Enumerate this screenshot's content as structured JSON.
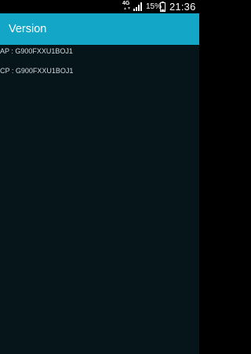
{
  "status_bar": {
    "network_type": "4G",
    "network_activity_icon": "up-down-arrows-icon",
    "signal_icon": "signal-strength-icon",
    "battery_percent": "15%",
    "battery_icon": "battery-low-icon",
    "time": "21:36"
  },
  "app_bar": {
    "title": "Version",
    "color": "#14a6c7"
  },
  "versions": {
    "ap": "AP : G900FXXU1BOJ1",
    "cp": "CP : G900FXXU1BOJ1"
  },
  "colors": {
    "background": "#06151a",
    "text": "#d4dadc"
  }
}
